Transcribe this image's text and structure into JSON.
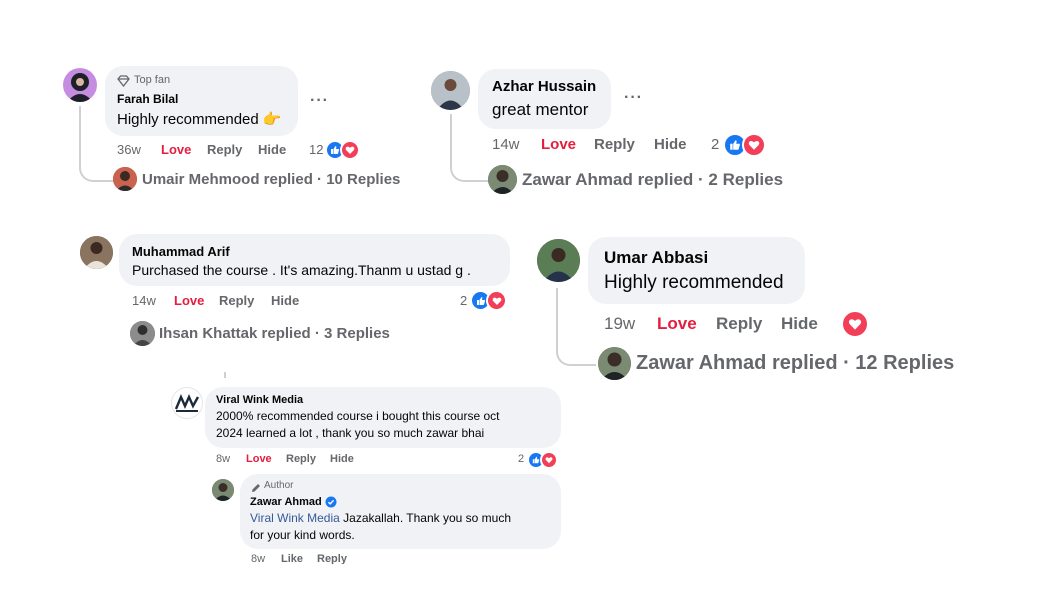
{
  "c1": {
    "badge": "Top fan",
    "name": "Farah Bilal",
    "text": "Highly recommended 👉",
    "time": "36w",
    "love": "Love",
    "reply": "Reply",
    "hide": "Hide",
    "count": "12",
    "replies": "Umair Mehmood replied · 10 Replies"
  },
  "c2": {
    "name": "Azhar Hussain",
    "text": "great mentor",
    "time": "14w",
    "love": "Love",
    "reply": "Reply",
    "hide": "Hide",
    "count": "2",
    "replies": "Zawar Ahmad replied · 2 Replies"
  },
  "c3": {
    "name": "Muhammad Arif",
    "text": "Purchased the course . It's amazing.Thanm u ustad g .",
    "time": "14w",
    "love": "Love",
    "reply": "Reply",
    "hide": "Hide",
    "count": "2",
    "replies": "Ihsan Khattak replied · 3 Replies"
  },
  "c4": {
    "name": "Umar Abbasi",
    "text": "Highly recommended",
    "time": "19w",
    "love": "Love",
    "reply": "Reply",
    "hide": "Hide",
    "replies": "Zawar Ahmad replied · 12 Replies"
  },
  "c5": {
    "name": "Viral Wink Media",
    "text1": "2000% recommended course i bought this course oct",
    "text2": "2024 learned a lot , thank you so much zawar bhai",
    "time": "8w",
    "love": "Love",
    "reply": "Reply",
    "hide": "Hide",
    "count": "2"
  },
  "c6": {
    "badge": "Author",
    "name": "Zawar Ahmad",
    "mention": "Viral Wink Media",
    "text1": " Jazakallah. Thank you so much",
    "text2": "for your kind words.",
    "time": "8w",
    "like": "Like",
    "reply": "Reply"
  },
  "dots": "···",
  "colors": {
    "love": "#e41e3f",
    "like": "#1877f2",
    "heart": "#f33e58",
    "bubble": "#f0f2f5",
    "muted": "#65676b"
  }
}
